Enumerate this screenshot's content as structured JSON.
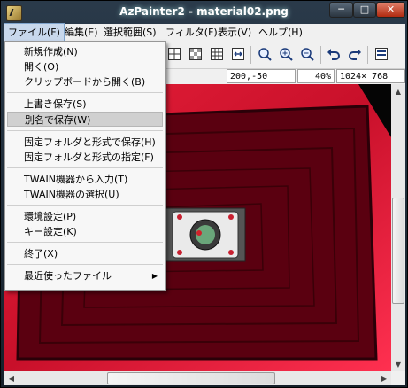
{
  "window": {
    "title": "AzPainter2 - material02.png",
    "controls": {
      "minimize": "─",
      "maximize": "□",
      "close": "✕"
    }
  },
  "menubar": {
    "items": [
      "ファイル(F)",
      "編集(E)",
      "選択範囲(S)",
      "フィルタ(F)",
      "表示(V)",
      "ヘルプ(H)"
    ],
    "active_index": 0
  },
  "toolbar": {
    "icons": [
      "new-canvas-icon",
      "transparency-icon",
      "grid-icon",
      "fit-width-icon",
      "zoom-icon",
      "zoom-in-icon",
      "zoom-out-icon",
      "undo-icon",
      "redo-icon",
      "panel-toggle-icon"
    ]
  },
  "status": {
    "cursor_pos": "200,-50",
    "zoom": "40%",
    "image_size": "1024× 768"
  },
  "file_menu": {
    "items": [
      {
        "label": "新規作成(N)"
      },
      {
        "label": "開く(O)"
      },
      {
        "label": "クリップボードから開く(B)"
      },
      {
        "label": "上書き保存(S)"
      },
      {
        "label": "別名で保存(W)",
        "highlighted": true
      },
      {
        "label": "固定フォルダと形式で保存(H)"
      },
      {
        "label": "固定フォルダと形式の指定(F)"
      },
      {
        "label": "TWAIN機器から入力(T)"
      },
      {
        "label": "TWAIN機器の選択(U)"
      },
      {
        "label": "環境設定(P)"
      },
      {
        "label": "キー設定(K)"
      },
      {
        "label": "終了(X)"
      },
      {
        "label": "最近使ったファイル",
        "submenu": true
      }
    ],
    "submenu_arrow": "▶"
  },
  "scrollbars": {
    "up": "▲",
    "down": "▼",
    "left": "◀",
    "right": "▶",
    "vertical_position": 0.45,
    "horizontal_position": 0.45
  },
  "colors": {
    "canvas_red": "#c8102a",
    "canvas_dark_red": "#6a0010",
    "highlight": "#d0d0d0"
  }
}
